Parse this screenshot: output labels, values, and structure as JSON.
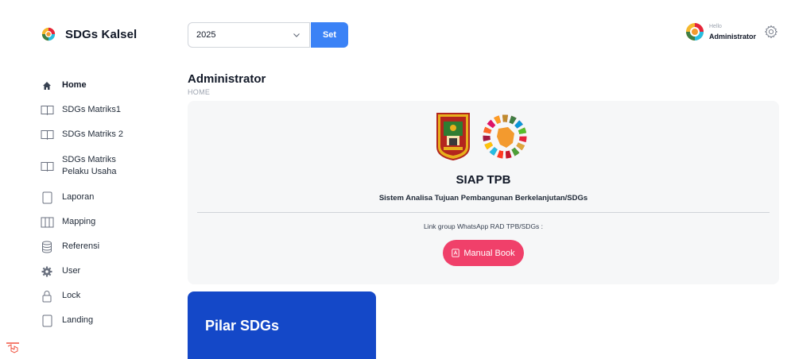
{
  "brand": {
    "name": "SDGs Kalsel",
    "logo_icon": "sdg-wheel-icon"
  },
  "sidebar": {
    "items": [
      {
        "label": "Home",
        "icon": "home-icon",
        "active": true
      },
      {
        "label": "SDGs Matriks1",
        "icon": "book-open-icon"
      },
      {
        "label": "SDGs Matriks 2",
        "icon": "book-open-icon"
      },
      {
        "label": "SDGs Matriks Pelaku Usaha",
        "icon": "book-open-icon"
      },
      {
        "label": "Laporan",
        "icon": "document-icon"
      },
      {
        "label": "Mapping",
        "icon": "columns-icon"
      },
      {
        "label": "Referensi",
        "icon": "database-icon"
      },
      {
        "label": "User",
        "icon": "cog-icon"
      },
      {
        "label": "Lock",
        "icon": "lock-icon"
      },
      {
        "label": "Landing",
        "icon": "document-icon"
      }
    ]
  },
  "topbar": {
    "year_value": "2025",
    "set_label": "Set",
    "greeting": "Hello",
    "user_name": "Administrator"
  },
  "page": {
    "title": "Administrator",
    "breadcrumb": "HOME"
  },
  "main_card": {
    "app_name": "SIAP TPB",
    "app_subtitle": "Sistem Analisa Tujuan Pembangunan Berkelanjutan/SDGs",
    "whatsapp_text": "Link group WhatsApp RAD TPB/SDGs :",
    "manual_button": "Manual Book"
  },
  "pilar": {
    "title": "Pilar SDGs"
  },
  "colors": {
    "primary": "#3b82f6",
    "pilar_blue": "#1448c8",
    "manual_pink": "#f0406a",
    "card_bg": "#f6f7f8"
  }
}
